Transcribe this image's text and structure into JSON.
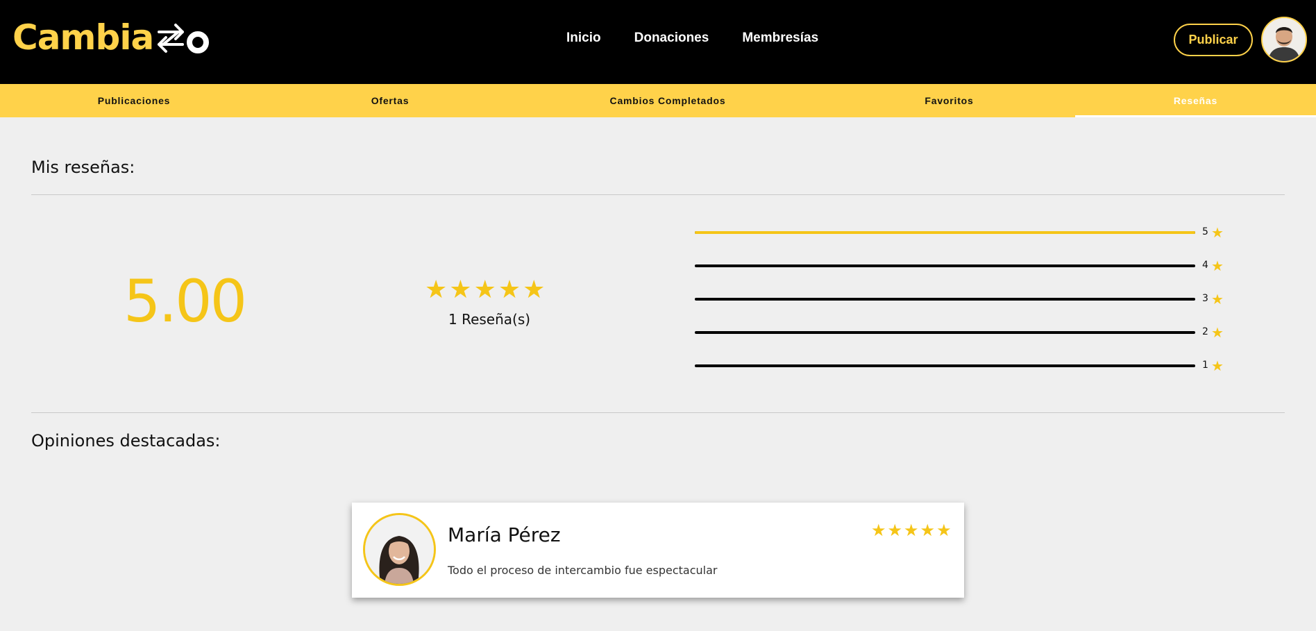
{
  "brand": {
    "name": "Cambia",
    "accent": "#ffd24a",
    "star_color": "#f5c518"
  },
  "nav": {
    "items": [
      {
        "label": "Inicio"
      },
      {
        "label": "Donaciones"
      },
      {
        "label": "Membresías"
      }
    ],
    "publish_label": "Publicar"
  },
  "tabs": [
    {
      "label": "Publicaciones",
      "active": false
    },
    {
      "label": "Ofertas",
      "active": false
    },
    {
      "label": "Cambios Completados",
      "active": false
    },
    {
      "label": "Favoritos",
      "active": false
    },
    {
      "label": "Reseñas",
      "active": true
    }
  ],
  "reviews": {
    "title": "Mis reseñas:",
    "average": "5.00",
    "stars": 5,
    "count_label": "1 Reseña(s)",
    "distribution": [
      {
        "stars": "5",
        "fraction": 1.0
      },
      {
        "stars": "4",
        "fraction": 0.0
      },
      {
        "stars": "3",
        "fraction": 0.0
      },
      {
        "stars": "2",
        "fraction": 0.0
      },
      {
        "stars": "1",
        "fraction": 0.0
      }
    ]
  },
  "featured": {
    "title": "Opiniones destacadas:",
    "items": [
      {
        "name": "María Pérez",
        "text": "Todo el proceso de intercambio fue espectacular",
        "stars": 5
      }
    ]
  }
}
